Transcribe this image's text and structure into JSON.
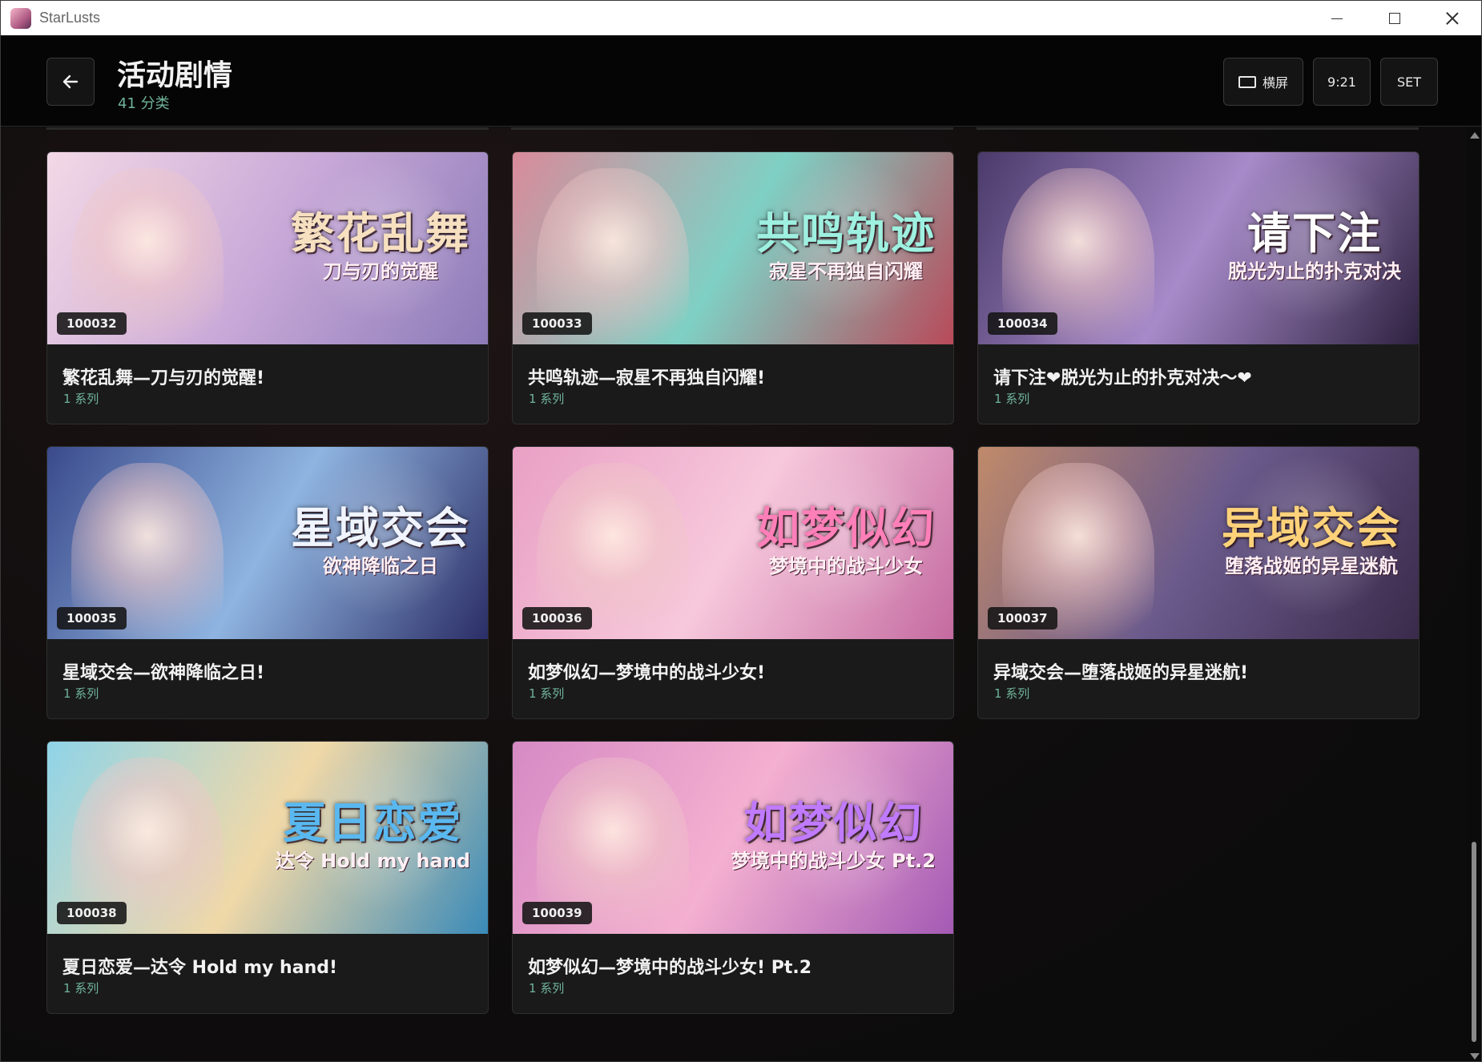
{
  "window": {
    "title": "StarLusts"
  },
  "header": {
    "title": "活动剧情",
    "subtitle": "41 分类",
    "orientation_label": "横屏",
    "ratio_label": "9:21",
    "set_label": "SET"
  },
  "cards": [
    {
      "id": "100032",
      "title": "繁花乱舞—刀与刃的觉醒!",
      "sub": "1 系列",
      "art_big": "繁花乱舞",
      "art_small": "刀与刃的觉醒",
      "colors": [
        "#f3d9e6",
        "#c9a9d8",
        "#8c7bb8"
      ],
      "art_color": "#f7e0c0"
    },
    {
      "id": "100033",
      "title": "共鸣轨迹—寂星不再独自闪耀!",
      "sub": "1 系列",
      "art_big": "共鸣轨迹",
      "art_small": "寂星不再独自闪耀",
      "colors": [
        "#d98a9a",
        "#7fd0c4",
        "#b84a5a"
      ],
      "art_color": "#9ef0e0"
    },
    {
      "id": "100034",
      "title": "请下注❤脱光为止的扑克对决～❤",
      "sub": "1 系列",
      "art_big": "请下注",
      "art_small": "脱光为止的扑克对决",
      "colors": [
        "#4a3a6a",
        "#a78ac9",
        "#2e2240"
      ],
      "art_color": "#ffffff"
    },
    {
      "id": "100035",
      "title": "星域交会—欲神降临之日!",
      "sub": "1 系列",
      "art_big": "星域交会",
      "art_small": "欲神降临之日",
      "colors": [
        "#3a4a8c",
        "#8fb4e0",
        "#2b2e66"
      ],
      "art_color": "#f0f4ff"
    },
    {
      "id": "100036",
      "title": "如梦似幻—梦境中的战斗少女!",
      "sub": "1 系列",
      "art_big": "如梦似幻",
      "art_small": "梦境中的战斗少女",
      "colors": [
        "#e9a0c4",
        "#f7c8dc",
        "#c46aa0"
      ],
      "art_color": "#ff7fb8"
    },
    {
      "id": "100037",
      "title": "异域交会—堕落战姬的异星迷航!",
      "sub": "1 系列",
      "art_big": "异域交会",
      "art_small": "堕落战姬的异星迷航",
      "colors": [
        "#c08a6a",
        "#6a5a8c",
        "#3a2a4a"
      ],
      "art_color": "#ffd27a"
    },
    {
      "id": "100038",
      "title": "夏日恋爱—达令 Hold my hand!",
      "sub": "1 系列",
      "art_big": "夏日恋爱",
      "art_small": "达令 Hold my hand",
      "colors": [
        "#8fd4e8",
        "#f0d8a8",
        "#3a8ab8"
      ],
      "art_color": "#5ab8f0"
    },
    {
      "id": "100039",
      "title": "如梦似幻—梦境中的战斗少女! Pt.2",
      "sub": "1 系列",
      "art_big": "如梦似幻",
      "art_small": "梦境中的战斗少女 Pt.2",
      "colors": [
        "#d68ac4",
        "#f4b0d0",
        "#a45ab4"
      ],
      "art_color": "#c07aff"
    }
  ]
}
